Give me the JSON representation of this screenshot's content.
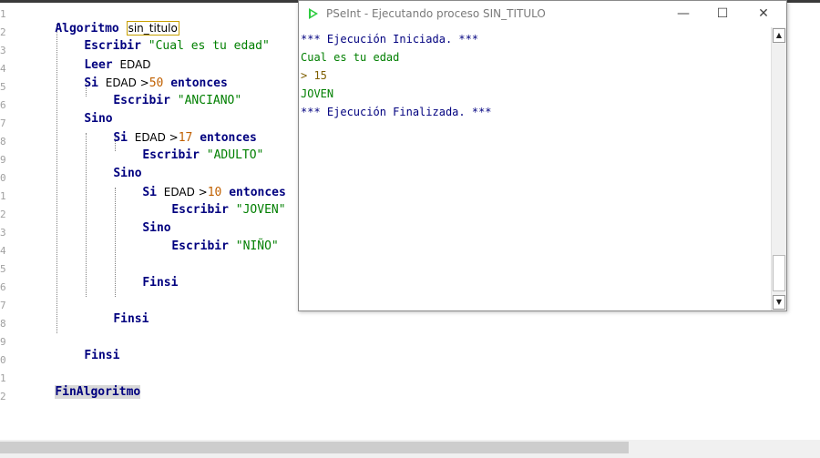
{
  "editor": {
    "line_numbers": [
      "1",
      "2",
      "3",
      "4",
      "5",
      "6",
      "7",
      "8",
      "9",
      "0",
      "1",
      "2",
      "3",
      "4",
      "5",
      "6",
      "7",
      "8",
      "9",
      "0",
      "1",
      "2"
    ],
    "code": {
      "l1_kw": "Algoritmo",
      "l1_name": "sin_titulo",
      "l2_kw": "Escribir",
      "l2_str": "\"Cual es tu edad\"",
      "l3_kw": "Leer",
      "l3_id": "EDAD",
      "l4_kw": "Si",
      "l4_id": "EDAD >",
      "l4_num": "50",
      "l4_kw2": "entonces",
      "l5_kw": "Escribir",
      "l5_str": "\"ANCIANO\"",
      "l6_kw": "Sino",
      "l7_kw": "Si",
      "l7_id": "EDAD >",
      "l7_num": "17",
      "l7_kw2": "entonces",
      "l8_kw": "Escribir",
      "l8_str": "\"ADULTO\"",
      "l9_kw": "Sino",
      "l10_kw": "Si",
      "l10_id": "EDAD >",
      "l10_num": "10",
      "l10_kw2": "entonces",
      "l11_kw": "Escribir",
      "l11_str": "\"JOVEN\"",
      "l12_kw": "Sino",
      "l13_kw": "Escribir",
      "l13_str": "\"NIÑO\"",
      "l15_kw": "Finsi",
      "l17_kw": "Finsi",
      "l19_kw": "Finsi",
      "l21_kw": "FinAlgoritmo"
    }
  },
  "console": {
    "title": "PSeInt - Ejecutando proceso SIN_TITULO",
    "minimize_icon": "minimize-icon",
    "maximize_icon": "maximize-icon",
    "close_icon": "close-icon",
    "lines": {
      "start": "*** Ejecución Iniciada. ***",
      "prompt": "Cual es tu edad",
      "input": "> 15",
      "output": "JOVEN",
      "end": "*** Ejecución Finalizada. ***"
    },
    "glyphs": {
      "min": "—",
      "max": "☐",
      "close": "✕",
      "up": "▲",
      "down": "▼"
    }
  },
  "colors": {
    "keyword": "#00007f",
    "string": "#007f00",
    "number": "#c06000",
    "psint_icon": "#2ecc40"
  }
}
